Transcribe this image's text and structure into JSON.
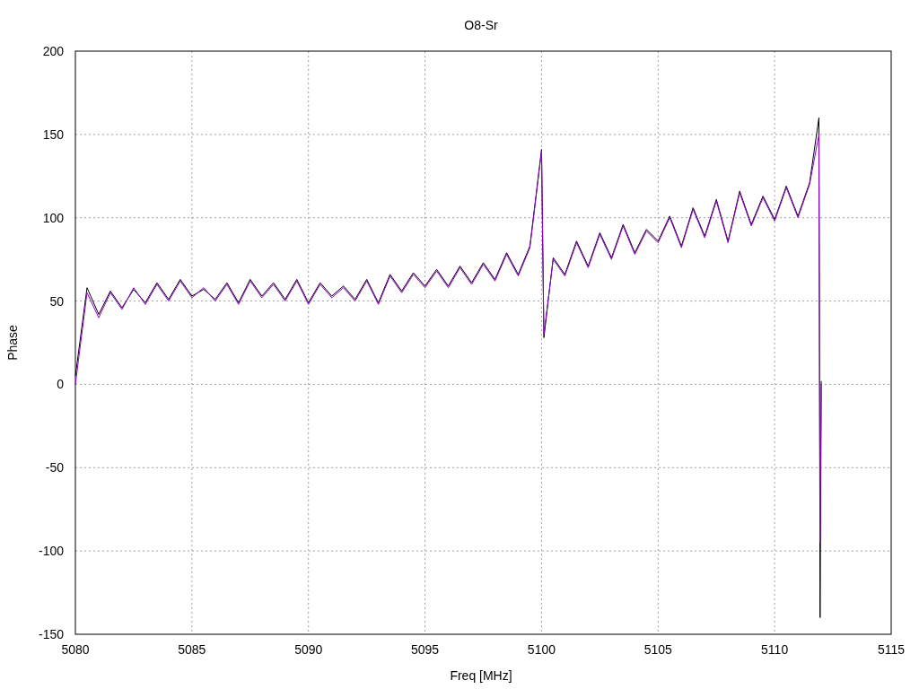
{
  "chart_data": {
    "type": "line",
    "title": "O8-Sr",
    "xlabel": "Freq [MHz]",
    "ylabel": "Phase",
    "grid": true,
    "xlim": [
      5080,
      5115
    ],
    "ylim": [
      -150,
      200
    ],
    "xticks": [
      5080,
      5085,
      5090,
      5095,
      5100,
      5105,
      5110,
      5115
    ],
    "yticks": [
      -150,
      -100,
      -50,
      0,
      50,
      100,
      150,
      200
    ],
    "x": [
      5080,
      5080.5,
      5081,
      5081.5,
      5082,
      5082.5,
      5083,
      5083.5,
      5084,
      5084.5,
      5085,
      5085.5,
      5086,
      5086.5,
      5087,
      5087.5,
      5088,
      5088.5,
      5089,
      5089.5,
      5090,
      5090.5,
      5091,
      5091.5,
      5092,
      5092.5,
      5093,
      5093.5,
      5094,
      5094.5,
      5095,
      5095.5,
      5096,
      5096.5,
      5097,
      5097.5,
      5098,
      5098.5,
      5099,
      5099.5,
      5100,
      5100.1,
      5100.5,
      5101,
      5101.5,
      5102,
      5102.5,
      5103,
      5103.5,
      5104,
      5104.5,
      5105,
      5105.5,
      5106,
      5106.5,
      5107,
      5107.5,
      5108,
      5108.5,
      5109,
      5109.5,
      5110,
      5110.5,
      5111,
      5111.5,
      5111.9,
      5111.95,
      5112
    ],
    "series": [
      {
        "color": "#000000",
        "values": [
          5,
          58,
          42,
          56,
          46,
          57,
          49,
          61,
          51,
          63,
          53,
          57,
          51,
          61,
          49,
          63,
          53,
          61,
          51,
          63,
          49,
          61,
          53,
          59,
          51,
          63,
          49,
          66,
          56,
          67,
          59,
          69,
          59,
          71,
          61,
          73,
          63,
          79,
          66,
          83,
          141,
          28,
          76,
          66,
          86,
          71,
          91,
          76,
          96,
          79,
          93,
          86,
          101,
          83,
          106,
          89,
          111,
          86,
          116,
          96,
          113,
          99,
          119,
          101,
          121,
          160,
          -140,
          2
        ]
      },
      {
        "color": "#9400d3",
        "values": [
          0,
          55,
          40,
          55,
          45,
          58,
          48,
          60,
          50,
          62,
          52,
          58,
          50,
          60,
          48,
          62,
          52,
          60,
          50,
          62,
          48,
          60,
          52,
          58,
          50,
          62,
          48,
          65,
          55,
          66,
          58,
          68,
          58,
          70,
          60,
          72,
          62,
          78,
          65,
          82,
          140,
          30,
          75,
          65,
          85,
          70,
          90,
          75,
          95,
          78,
          92,
          85,
          100,
          82,
          105,
          88,
          110,
          85,
          115,
          95,
          112,
          98,
          118,
          100,
          120,
          150,
          -95,
          0
        ]
      }
    ]
  }
}
